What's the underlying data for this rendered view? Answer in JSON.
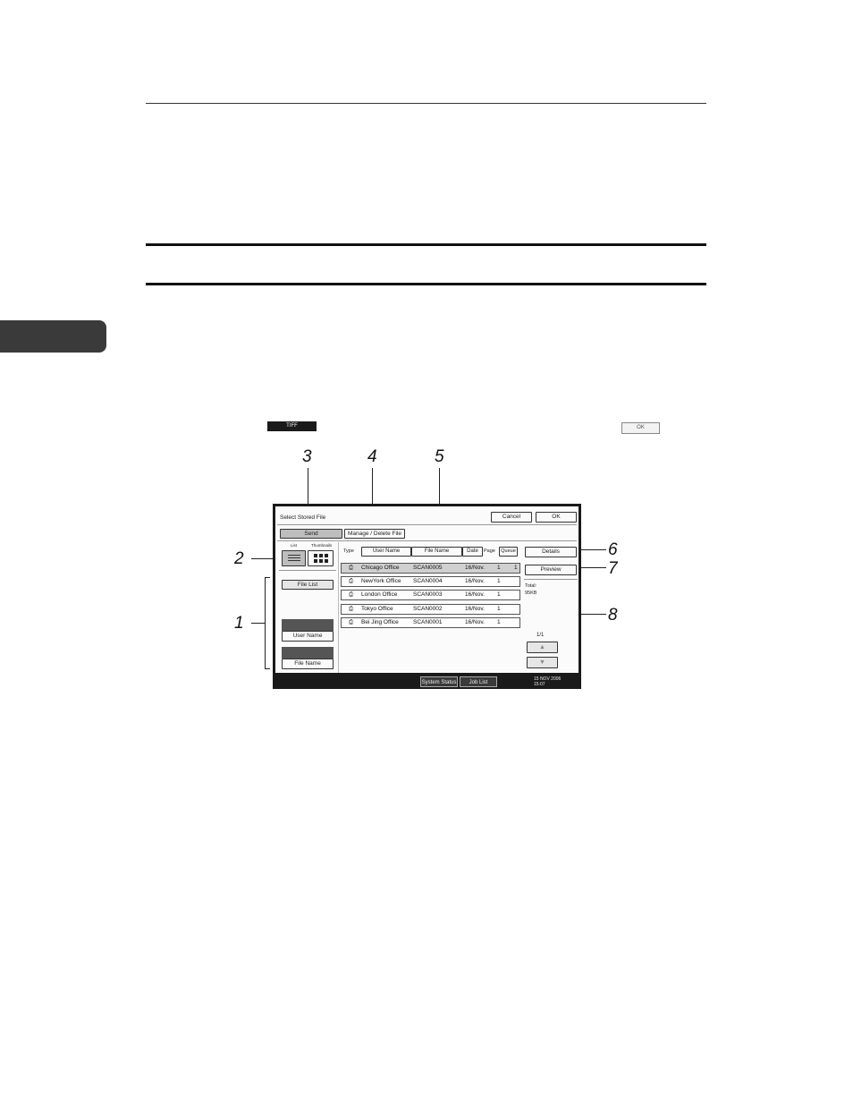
{
  "tiff_key": "TIFF",
  "ok_key": "OK",
  "callouts": [
    "1",
    "2",
    "3",
    "4",
    "5",
    "6",
    "7",
    "8"
  ],
  "screen": {
    "title": "Select Stored File",
    "cancel": "Cancel",
    "ok": "OK",
    "tab_send": "Send",
    "tab_manage": "Manage / Delete File",
    "view_list": "List",
    "view_thumbnails": "Thumbnails",
    "col_type": "Type",
    "col_user": "User Name",
    "col_file": "File Name",
    "col_date": "Date",
    "col_page": "Page",
    "col_queue": "Queue",
    "details": "Details",
    "preview": "Preview",
    "file_list": "File List",
    "user_name": "User Name",
    "file_name": "File Name",
    "total_label": "Total:",
    "total_value": "95KB",
    "page_indicator": "1/1",
    "rows": [
      {
        "user": "Chicago Office",
        "file": "SCAN0005",
        "date": "16/Nov.",
        "page": "1",
        "queue": "1"
      },
      {
        "user": "NewYork Office",
        "file": "SCAN0004",
        "date": "16/Nov.",
        "page": "1",
        "queue": ""
      },
      {
        "user": "London Office",
        "file": "SCAN0003",
        "date": "16/Nov.",
        "page": "1",
        "queue": ""
      },
      {
        "user": "Tokyo Office",
        "file": "SCAN0002",
        "date": "16/Nov.",
        "page": "1",
        "queue": ""
      },
      {
        "user": "Bei Jing Office",
        "file": "SCAN0001",
        "date": "16/Nov.",
        "page": "1",
        "queue": ""
      }
    ],
    "status": {
      "system_status": "System Status",
      "job_list": "Job List",
      "date": "15 NOV  2006",
      "time": "15:07"
    }
  }
}
